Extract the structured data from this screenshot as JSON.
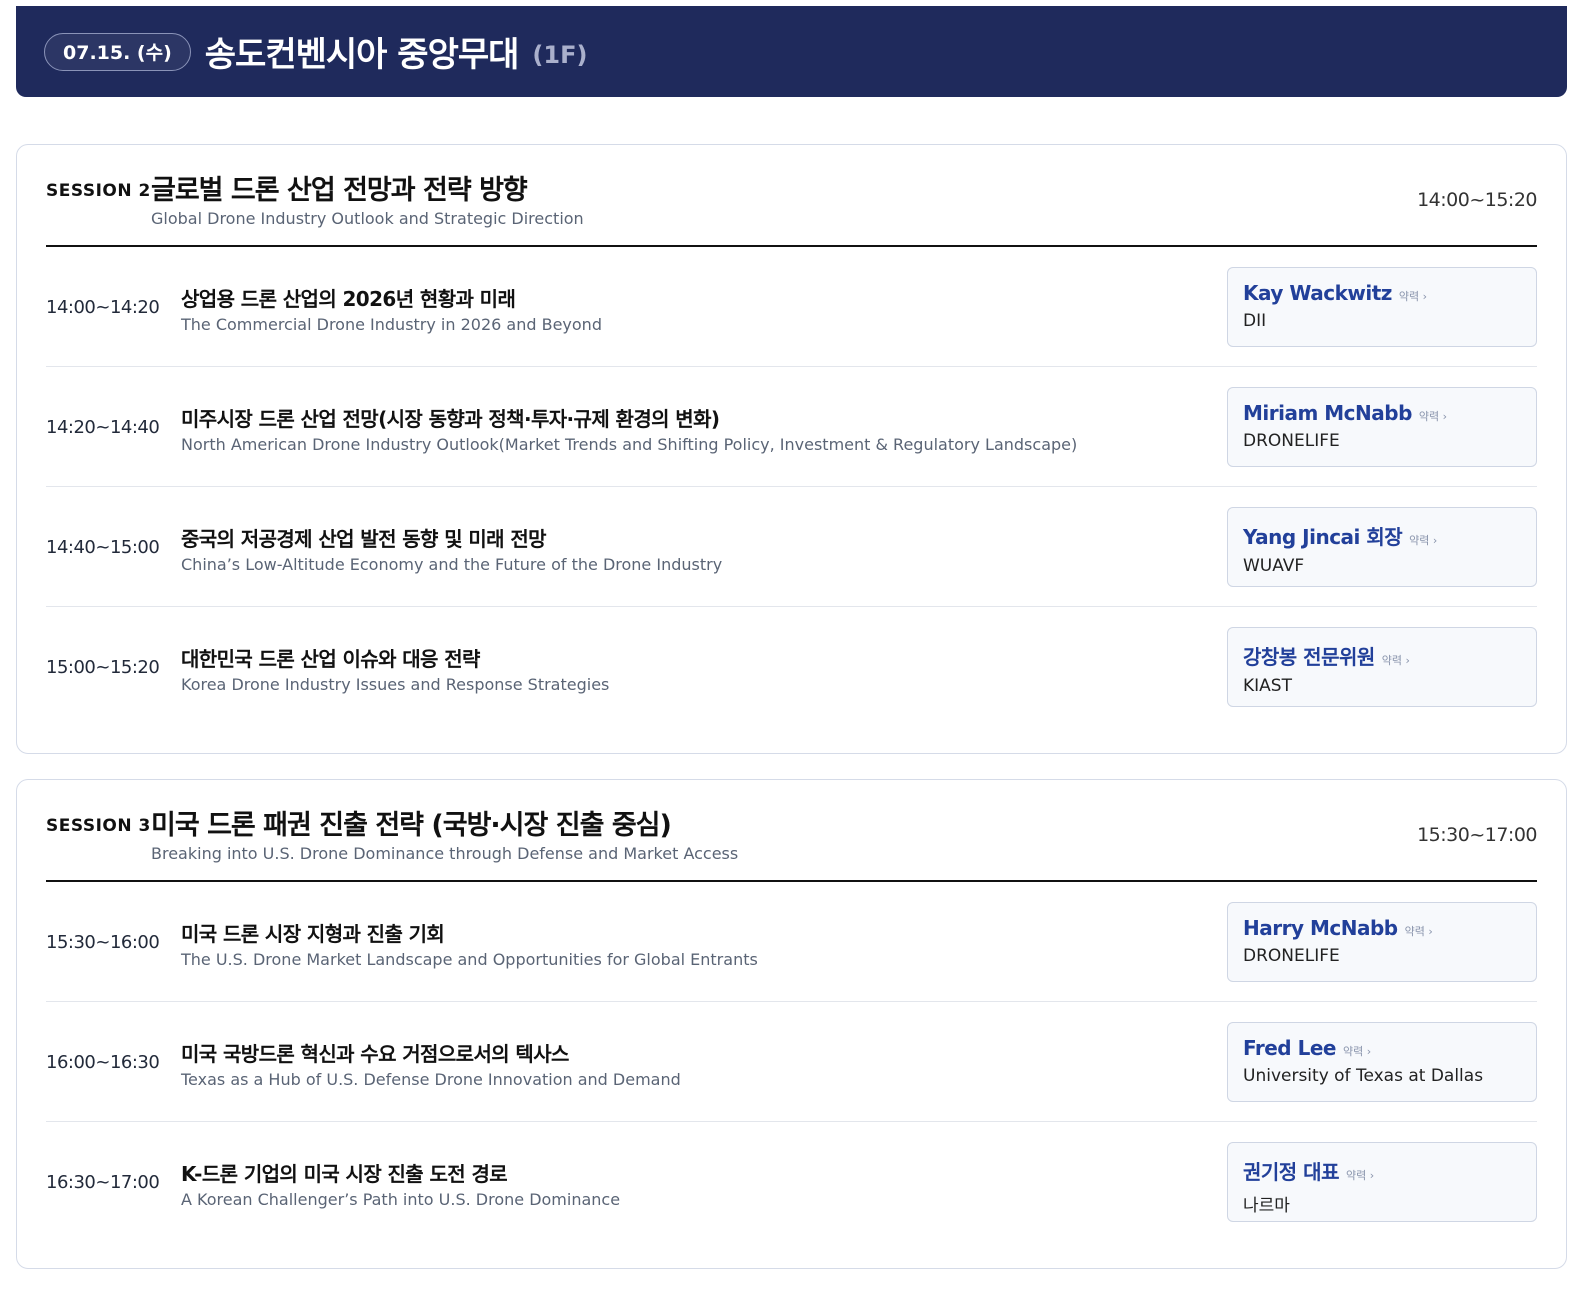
{
  "header": {
    "date": "07.15. (수)",
    "venue": "송도컨벤시아 중앙무대",
    "floor": "(1F)"
  },
  "sessions": [
    {
      "label": "SESSION 2",
      "title": "글로벌 드론 산업 전망과 전략 방향",
      "subtitle": "Global Drone Industry Outlook and Strategic Direction",
      "time": "14:00~15:20",
      "talks": [
        {
          "time": "14:00~14:20",
          "title": "상업용 드론 산업의 2026년 현황과 미래",
          "subtitle": "The Commercial Drone Industry in 2026 and Beyond",
          "speaker": "Kay Wackwitz",
          "bio_link": "약력 ›",
          "org": "DII"
        },
        {
          "time": "14:20~14:40",
          "title": "미주시장 드론 산업 전망(시장 동향과 정책·투자·규제 환경의 변화)",
          "subtitle": "North American Drone Industry Outlook(Market Trends and Shifting Policy, Investment & Regulatory Landscape)",
          "speaker": "Miriam McNabb",
          "bio_link": "약력 ›",
          "org": "DRONELIFE"
        },
        {
          "time": "14:40~15:00",
          "title": "중국의 저공경제 산업 발전 동향 및 미래 전망",
          "subtitle": "China’s Low-Altitude Economy and the Future of the Drone Industry",
          "speaker": "Yang Jincai 회장",
          "bio_link": "약력 ›",
          "org": "WUAVF"
        },
        {
          "time": "15:00~15:20",
          "title": "대한민국 드론 산업 이슈와 대응 전략",
          "subtitle": "Korea Drone Industry Issues and Response Strategies",
          "speaker": "강창봉 전문위원",
          "bio_link": "약력 ›",
          "org": "KIAST"
        }
      ]
    },
    {
      "label": "SESSION 3",
      "title": "미국 드론 패권 진출 전략 (국방·시장 진출 중심)",
      "subtitle": "Breaking into U.S. Drone Dominance through Defense and Market Access",
      "time": "15:30~17:00",
      "talks": [
        {
          "time": "15:30~16:00",
          "title": "미국 드론 시장 지형과 진출 기회",
          "subtitle": "The U.S. Drone Market Landscape and Opportunities for Global Entrants",
          "speaker": "Harry McNabb",
          "bio_link": "약력 ›",
          "org": "DRONELIFE"
        },
        {
          "time": "16:00~16:30",
          "title": "미국 국방드론 혁신과 수요 거점으로서의 텍사스",
          "subtitle": "Texas as a Hub of U.S. Defense Drone Innovation and Demand",
          "speaker": "Fred Lee",
          "bio_link": "약력 ›",
          "org": "University of Texas at Dallas"
        },
        {
          "time": "16:30~17:00",
          "title": "K-드론 기업의 미국 시장 진출 도전 경로",
          "subtitle": "A Korean Challenger’s Path into U.S. Drone Dominance",
          "speaker": "권기정 대표",
          "bio_link": "약력 ›",
          "org": "나르마"
        }
      ]
    }
  ]
}
